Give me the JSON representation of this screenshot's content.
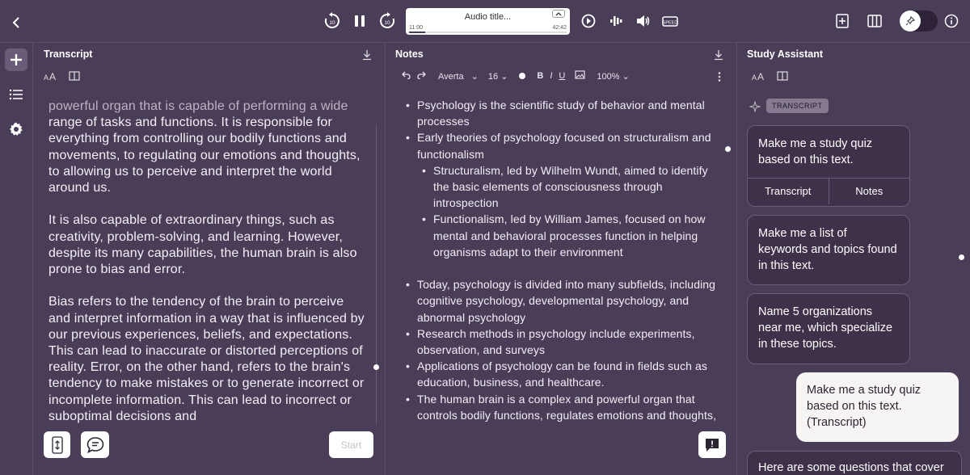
{
  "player": {
    "audio_title": "Audio title...",
    "time_current": "11:00",
    "time_total": "42:42",
    "speed_label": "SPEED"
  },
  "transcript": {
    "title": "Transcript",
    "paragraphs": [
      {
        "faded": "powerful organ that is capable of performing a wide",
        "text": "range of tasks and functions. It is responsible for everything from controlling our bodily functions and movements, to regulating our emotions and thoughts, to allowing us to perceive and interpret the world around us."
      },
      {
        "faded": "",
        "text": "It is also capable of extraordinary things, such as creativity, problem-solving, and learning. However, despite its many capabilities, the human brain is also prone to bias and error."
      },
      {
        "faded": "",
        "text": "Bias refers to the tendency of the brain to perceive and interpret information in a way that is influenced by our previous experiences, beliefs, and expectations. This can lead to inaccurate or distorted perceptions of reality. Error, on the other hand, refers to the brain's tendency to make mistakes or to generate incorrect or incomplete information. This can lead to incorrect or suboptimal decisions and"
      }
    ],
    "start_label": "Start"
  },
  "notes": {
    "title": "Notes",
    "font": "Averta",
    "font_size": "16",
    "zoom": "100%",
    "items": [
      {
        "level": 1,
        "text": "Psychology is the scientific study of behavior and mental processes"
      },
      {
        "level": 1,
        "text": "Early theories of psychology focused on structuralism and functionalism"
      },
      {
        "level": 2,
        "text": "Structuralism, led by Wilhelm Wundt, aimed to identify the basic elements of consciousness through introspection"
      },
      {
        "level": 2,
        "text": "Functionalism, led by William James, focused on how mental and behavioral processes function in helping organisms adapt to their environment"
      },
      {
        "level": 0,
        "text": ""
      },
      {
        "level": 1,
        "text": "Today, psychology is divided into many subfields, including cognitive psychology, developmental psychology, and abnormal psychology"
      },
      {
        "level": 1,
        "text": "Research methods in psychology include experiments, observation, and surveys"
      },
      {
        "level": 1,
        "text": "Applications of psychology can be found in fields such as education, business, and healthcare."
      },
      {
        "level": 1,
        "text": "The human brain is a complex and powerful organ that controls bodily functions, regulates emotions and thoughts,"
      }
    ]
  },
  "assistant": {
    "title": "Study Assistant",
    "source_pill": "TRANSCRIPT",
    "suggestions": [
      {
        "text": "Make me a study quiz based on this text.",
        "options": [
          "Transcript",
          "Notes"
        ]
      },
      {
        "text": "Make me a list of keywords and topics found in this text."
      },
      {
        "text": "Name 5 organizations near me, which specialize in these topics."
      }
    ],
    "user_message": "Make me a study quiz based on this text. (Transcript)",
    "answer_preview": "Here are some questions that cover"
  },
  "colors": {
    "background": "#4a3d58",
    "card": "#3e3149",
    "bubble": "#f7f5f4"
  }
}
